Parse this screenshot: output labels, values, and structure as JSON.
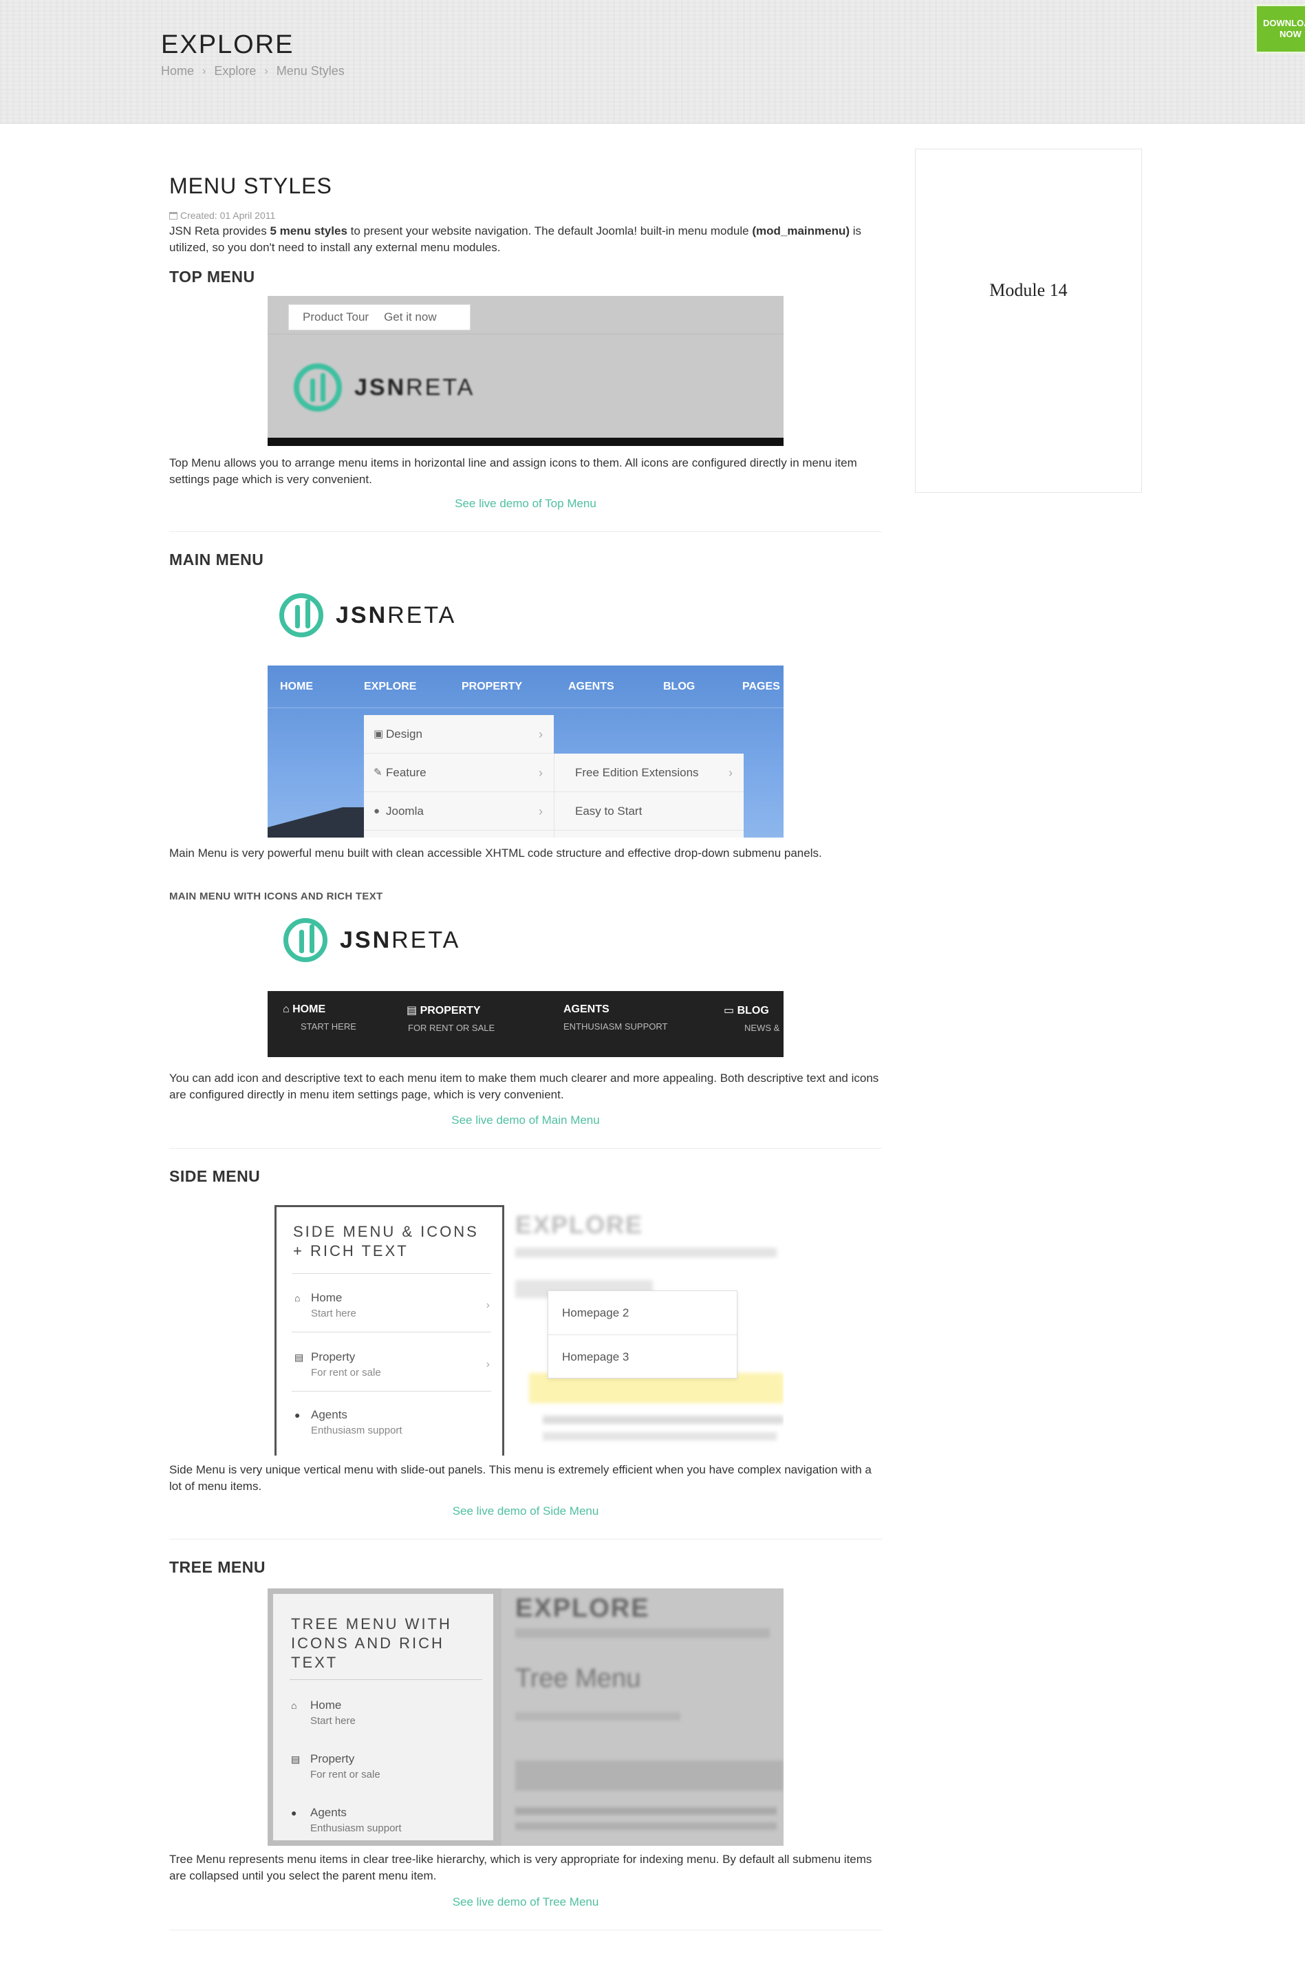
{
  "header": {
    "page_heading": "EXPLORE",
    "breadcrumb": [
      "Home",
      "Explore",
      "Menu Styles"
    ],
    "download_button": [
      "DOWNLOAD",
      "NOW"
    ]
  },
  "article": {
    "title": "MENU STYLES",
    "created": "Created: 01 April 2011",
    "intro_parts": [
      "JSN Reta provides ",
      "5 menu styles",
      " to present your website navigation. The default Joomla! built-in menu module ",
      "(mod_mainmenu)",
      " is utilized, so you don't need to install any external menu modules."
    ]
  },
  "sections": {
    "top": {
      "title": "TOP MENU",
      "shot_menu": [
        "Product Tour",
        "Get it now"
      ],
      "logo_bold": "JSN",
      "logo_light": "RETA",
      "description": "Top Menu allows you to arrange menu items in horizontal line and assign icons to them. All icons are configured directly in menu item settings page which is very convenient.",
      "link": "See live demo of Top Menu"
    },
    "main": {
      "title": "MAIN MENU",
      "logo_bold": "JSN",
      "logo_light": "RETA",
      "nav": [
        "HOME",
        "EXPLORE",
        "PROPERTY",
        "AGENTS",
        "BLOG",
        "PAGES"
      ],
      "dropdown": [
        "Design",
        "Feature",
        "Joomla"
      ],
      "submenu": [
        "Free Edition Extensions",
        "Easy to Start"
      ],
      "description": "Main Menu is very powerful menu built with clean accessible XHTML code structure and effective drop-down submenu panels.",
      "subtitle": "MAIN MENU WITH ICONS AND RICH TEXT",
      "icon_nav": [
        {
          "title": "HOME",
          "sub": "START HERE"
        },
        {
          "title": "PROPERTY",
          "sub": "FOR RENT OR SALE"
        },
        {
          "title": "AGENTS",
          "sub": "ENTHUSIASM SUPPORT"
        },
        {
          "title": "BLOG",
          "sub": "NEWS &"
        }
      ],
      "description2": "You can add icon and descriptive text to each menu item to make them much clearer and more appealing. Both descriptive text and icons are configured directly in menu item settings page, which is very convenient.",
      "link": "See live demo of Main Menu"
    },
    "side": {
      "title": "SIDE MENU",
      "panel_title": [
        "SIDE MENU & ICONS",
        "+ RICH TEXT"
      ],
      "items": [
        {
          "title": "Home",
          "sub": "Start here"
        },
        {
          "title": "Property",
          "sub": "For rent or sale"
        },
        {
          "title": "Agents",
          "sub": "Enthusiasm support"
        }
      ],
      "flyout": [
        "Homepage 2",
        "Homepage 3"
      ],
      "bg_heading": "EXPLORE",
      "description": "Side Menu is very unique vertical menu with slide-out panels. This menu is extremely efficient when you have complex navigation with a lot of menu items.",
      "link": "See live demo of Side Menu"
    },
    "tree": {
      "title": "TREE MENU",
      "panel_title": [
        "TREE MENU WITH",
        "ICONS AND RICH",
        "TEXT"
      ],
      "items": [
        {
          "title": "Home",
          "sub": "Start here"
        },
        {
          "title": "Property",
          "sub": "For rent or sale"
        },
        {
          "title": "Agents",
          "sub": "Enthusiasm support"
        }
      ],
      "bg_heading": "EXPLORE",
      "bg_title": "Tree Menu",
      "description": "Tree Menu represents menu items in clear tree-like hierarchy, which is very appropriate for indexing menu. By default all submenu items are collapsed until you select the parent menu item.",
      "link": "See live demo of Tree Menu"
    }
  },
  "sidebar": {
    "module_label": "Module 14"
  },
  "colors": {
    "link": "#4fbfa0",
    "download": "#72c02c",
    "logo": "#3fc0a0"
  }
}
